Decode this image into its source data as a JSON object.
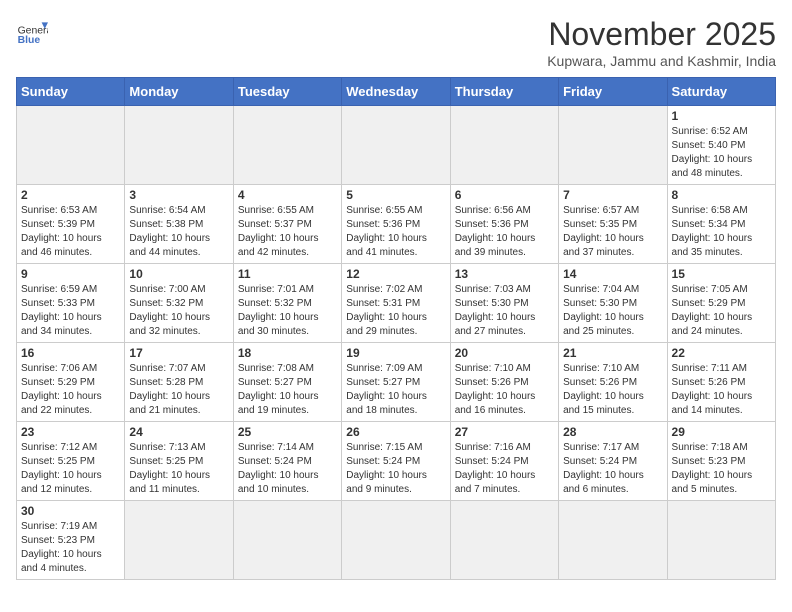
{
  "logo": {
    "text_general": "General",
    "text_blue": "Blue"
  },
  "title": "November 2025",
  "subtitle": "Kupwara, Jammu and Kashmir, India",
  "days_of_week": [
    "Sunday",
    "Monday",
    "Tuesday",
    "Wednesday",
    "Thursday",
    "Friday",
    "Saturday"
  ],
  "weeks": [
    [
      {
        "day": "",
        "info": ""
      },
      {
        "day": "",
        "info": ""
      },
      {
        "day": "",
        "info": ""
      },
      {
        "day": "",
        "info": ""
      },
      {
        "day": "",
        "info": ""
      },
      {
        "day": "",
        "info": ""
      },
      {
        "day": "1",
        "info": "Sunrise: 6:52 AM\nSunset: 5:40 PM\nDaylight: 10 hours and 48 minutes."
      }
    ],
    [
      {
        "day": "2",
        "info": "Sunrise: 6:53 AM\nSunset: 5:39 PM\nDaylight: 10 hours and 46 minutes."
      },
      {
        "day": "3",
        "info": "Sunrise: 6:54 AM\nSunset: 5:38 PM\nDaylight: 10 hours and 44 minutes."
      },
      {
        "day": "4",
        "info": "Sunrise: 6:55 AM\nSunset: 5:37 PM\nDaylight: 10 hours and 42 minutes."
      },
      {
        "day": "5",
        "info": "Sunrise: 6:55 AM\nSunset: 5:36 PM\nDaylight: 10 hours and 41 minutes."
      },
      {
        "day": "6",
        "info": "Sunrise: 6:56 AM\nSunset: 5:36 PM\nDaylight: 10 hours and 39 minutes."
      },
      {
        "day": "7",
        "info": "Sunrise: 6:57 AM\nSunset: 5:35 PM\nDaylight: 10 hours and 37 minutes."
      },
      {
        "day": "8",
        "info": "Sunrise: 6:58 AM\nSunset: 5:34 PM\nDaylight: 10 hours and 35 minutes."
      }
    ],
    [
      {
        "day": "9",
        "info": "Sunrise: 6:59 AM\nSunset: 5:33 PM\nDaylight: 10 hours and 34 minutes."
      },
      {
        "day": "10",
        "info": "Sunrise: 7:00 AM\nSunset: 5:32 PM\nDaylight: 10 hours and 32 minutes."
      },
      {
        "day": "11",
        "info": "Sunrise: 7:01 AM\nSunset: 5:32 PM\nDaylight: 10 hours and 30 minutes."
      },
      {
        "day": "12",
        "info": "Sunrise: 7:02 AM\nSunset: 5:31 PM\nDaylight: 10 hours and 29 minutes."
      },
      {
        "day": "13",
        "info": "Sunrise: 7:03 AM\nSunset: 5:30 PM\nDaylight: 10 hours and 27 minutes."
      },
      {
        "day": "14",
        "info": "Sunrise: 7:04 AM\nSunset: 5:30 PM\nDaylight: 10 hours and 25 minutes."
      },
      {
        "day": "15",
        "info": "Sunrise: 7:05 AM\nSunset: 5:29 PM\nDaylight: 10 hours and 24 minutes."
      }
    ],
    [
      {
        "day": "16",
        "info": "Sunrise: 7:06 AM\nSunset: 5:29 PM\nDaylight: 10 hours and 22 minutes."
      },
      {
        "day": "17",
        "info": "Sunrise: 7:07 AM\nSunset: 5:28 PM\nDaylight: 10 hours and 21 minutes."
      },
      {
        "day": "18",
        "info": "Sunrise: 7:08 AM\nSunset: 5:27 PM\nDaylight: 10 hours and 19 minutes."
      },
      {
        "day": "19",
        "info": "Sunrise: 7:09 AM\nSunset: 5:27 PM\nDaylight: 10 hours and 18 minutes."
      },
      {
        "day": "20",
        "info": "Sunrise: 7:10 AM\nSunset: 5:26 PM\nDaylight: 10 hours and 16 minutes."
      },
      {
        "day": "21",
        "info": "Sunrise: 7:10 AM\nSunset: 5:26 PM\nDaylight: 10 hours and 15 minutes."
      },
      {
        "day": "22",
        "info": "Sunrise: 7:11 AM\nSunset: 5:26 PM\nDaylight: 10 hours and 14 minutes."
      }
    ],
    [
      {
        "day": "23",
        "info": "Sunrise: 7:12 AM\nSunset: 5:25 PM\nDaylight: 10 hours and 12 minutes."
      },
      {
        "day": "24",
        "info": "Sunrise: 7:13 AM\nSunset: 5:25 PM\nDaylight: 10 hours and 11 minutes."
      },
      {
        "day": "25",
        "info": "Sunrise: 7:14 AM\nSunset: 5:24 PM\nDaylight: 10 hours and 10 minutes."
      },
      {
        "day": "26",
        "info": "Sunrise: 7:15 AM\nSunset: 5:24 PM\nDaylight: 10 hours and 9 minutes."
      },
      {
        "day": "27",
        "info": "Sunrise: 7:16 AM\nSunset: 5:24 PM\nDaylight: 10 hours and 7 minutes."
      },
      {
        "day": "28",
        "info": "Sunrise: 7:17 AM\nSunset: 5:24 PM\nDaylight: 10 hours and 6 minutes."
      },
      {
        "day": "29",
        "info": "Sunrise: 7:18 AM\nSunset: 5:23 PM\nDaylight: 10 hours and 5 minutes."
      }
    ],
    [
      {
        "day": "30",
        "info": "Sunrise: 7:19 AM\nSunset: 5:23 PM\nDaylight: 10 hours and 4 minutes."
      },
      {
        "day": "",
        "info": ""
      },
      {
        "day": "",
        "info": ""
      },
      {
        "day": "",
        "info": ""
      },
      {
        "day": "",
        "info": ""
      },
      {
        "day": "",
        "info": ""
      },
      {
        "day": "",
        "info": ""
      }
    ]
  ]
}
